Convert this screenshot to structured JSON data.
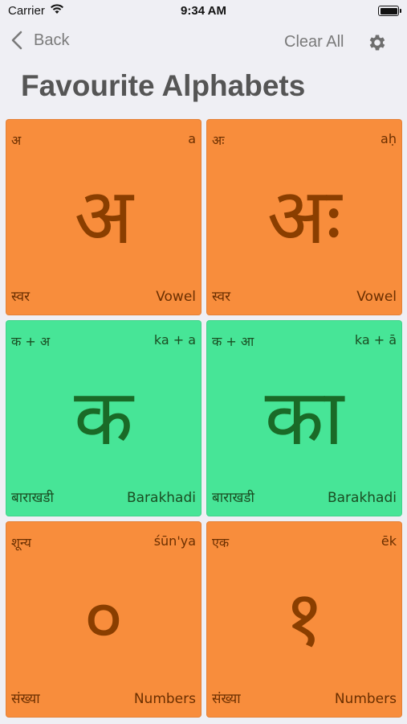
{
  "status_bar": {
    "carrier": "Carrier",
    "time": "9:34 AM",
    "icons": [
      "wifi-icon",
      "battery-icon"
    ]
  },
  "nav": {
    "back_label": "Back",
    "clear_label": "Clear All",
    "settings_icon": "gear-icon"
  },
  "title": "Favourite Alphabets",
  "colors": {
    "vowel_card": "#f88d3c",
    "barakhadi_card": "#47e597",
    "background": "#efeff4"
  },
  "cards": [
    {
      "top_left": "अ",
      "top_right": "a",
      "glyph": "अ",
      "bottom_left": "स्वर",
      "bottom_right": "Vowel",
      "color": "orange"
    },
    {
      "top_left": "अः",
      "top_right": "aḥ",
      "glyph": "अः",
      "bottom_left": "स्वर",
      "bottom_right": "Vowel",
      "color": "orange"
    },
    {
      "top_left": "क + अ",
      "top_right": "ka + a",
      "glyph": "क",
      "bottom_left": "बाराखडी",
      "bottom_right": "Barakhadi",
      "color": "green"
    },
    {
      "top_left": "क + आ",
      "top_right": "ka + ā",
      "glyph": "का",
      "bottom_left": "बाराखडी",
      "bottom_right": "Barakhadi",
      "color": "green"
    },
    {
      "top_left": "शून्य",
      "top_right": "śūn'ya",
      "glyph": "०",
      "bottom_left": "संख्या",
      "bottom_right": "Numbers",
      "color": "orange"
    },
    {
      "top_left": "एक",
      "top_right": "ēk",
      "glyph": "१",
      "bottom_left": "संख्या",
      "bottom_right": "Numbers",
      "color": "orange"
    }
  ]
}
